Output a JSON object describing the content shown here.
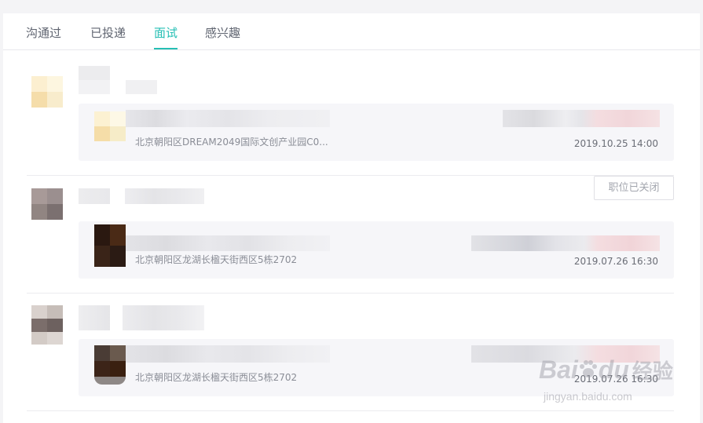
{
  "tabs": [
    {
      "label": "沟通过",
      "active": false
    },
    {
      "label": "已投递",
      "active": false
    },
    {
      "label": "面试",
      "active": true
    },
    {
      "label": "感兴趣",
      "active": false
    }
  ],
  "accent_color": "#26bfb4",
  "interviews": [
    {
      "address": "北京朝阳区DREAM2049国际文创产业园C0...",
      "time": "2019.10.25 14:00",
      "status": ""
    },
    {
      "address": "北京朝阳区龙湖长楹天街西区5栋2702",
      "time": "2019.07.26 16:30",
      "status": "职位已关闭"
    },
    {
      "address": "北京朝阳区龙湖长楹天街西区5栋2702",
      "time": "2019.07.26 16:30",
      "status": ""
    }
  ],
  "watermark": {
    "brand": "Bai",
    "brand2": "du",
    "product": "经验",
    "url": "jingyan.baidu.com"
  }
}
